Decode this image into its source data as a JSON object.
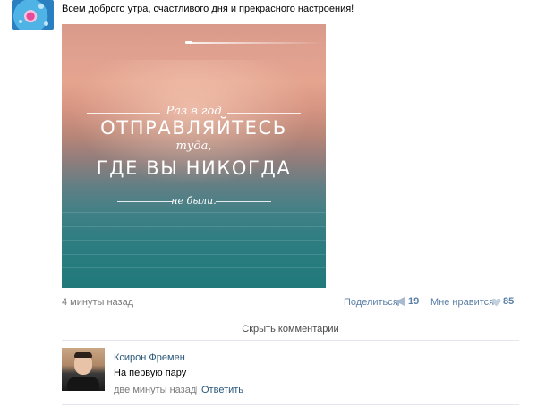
{
  "post": {
    "text": "Всем доброго утра, счастливого дня и прекрасного настроения!",
    "time": "4 минуты назад",
    "image_quote": {
      "line1": "Раз в год",
      "line2": "ОТПРАВЛЯЙТЕСЬ",
      "line3": "туда,",
      "line4": "ГДЕ ВЫ НИКОГДА",
      "line5": "не были."
    },
    "share_label": "Поделиться",
    "share_count": "19",
    "like_label": "Мне нравится",
    "like_count": "85"
  },
  "comments_toggle": "Скрыть комментарии",
  "comment": {
    "author": "Ксирон Фремен",
    "text": "На первую пару",
    "time": "две минуты назад",
    "separator": "|",
    "reply_label": "Ответить"
  },
  "icons": {
    "share": "megaphone-icon",
    "like": "heart-icon"
  },
  "colors": {
    "link": "#2b587a",
    "action_link": "#5b7fa6",
    "meta": "#7a7a7a",
    "divider": "#e3e7ec"
  }
}
